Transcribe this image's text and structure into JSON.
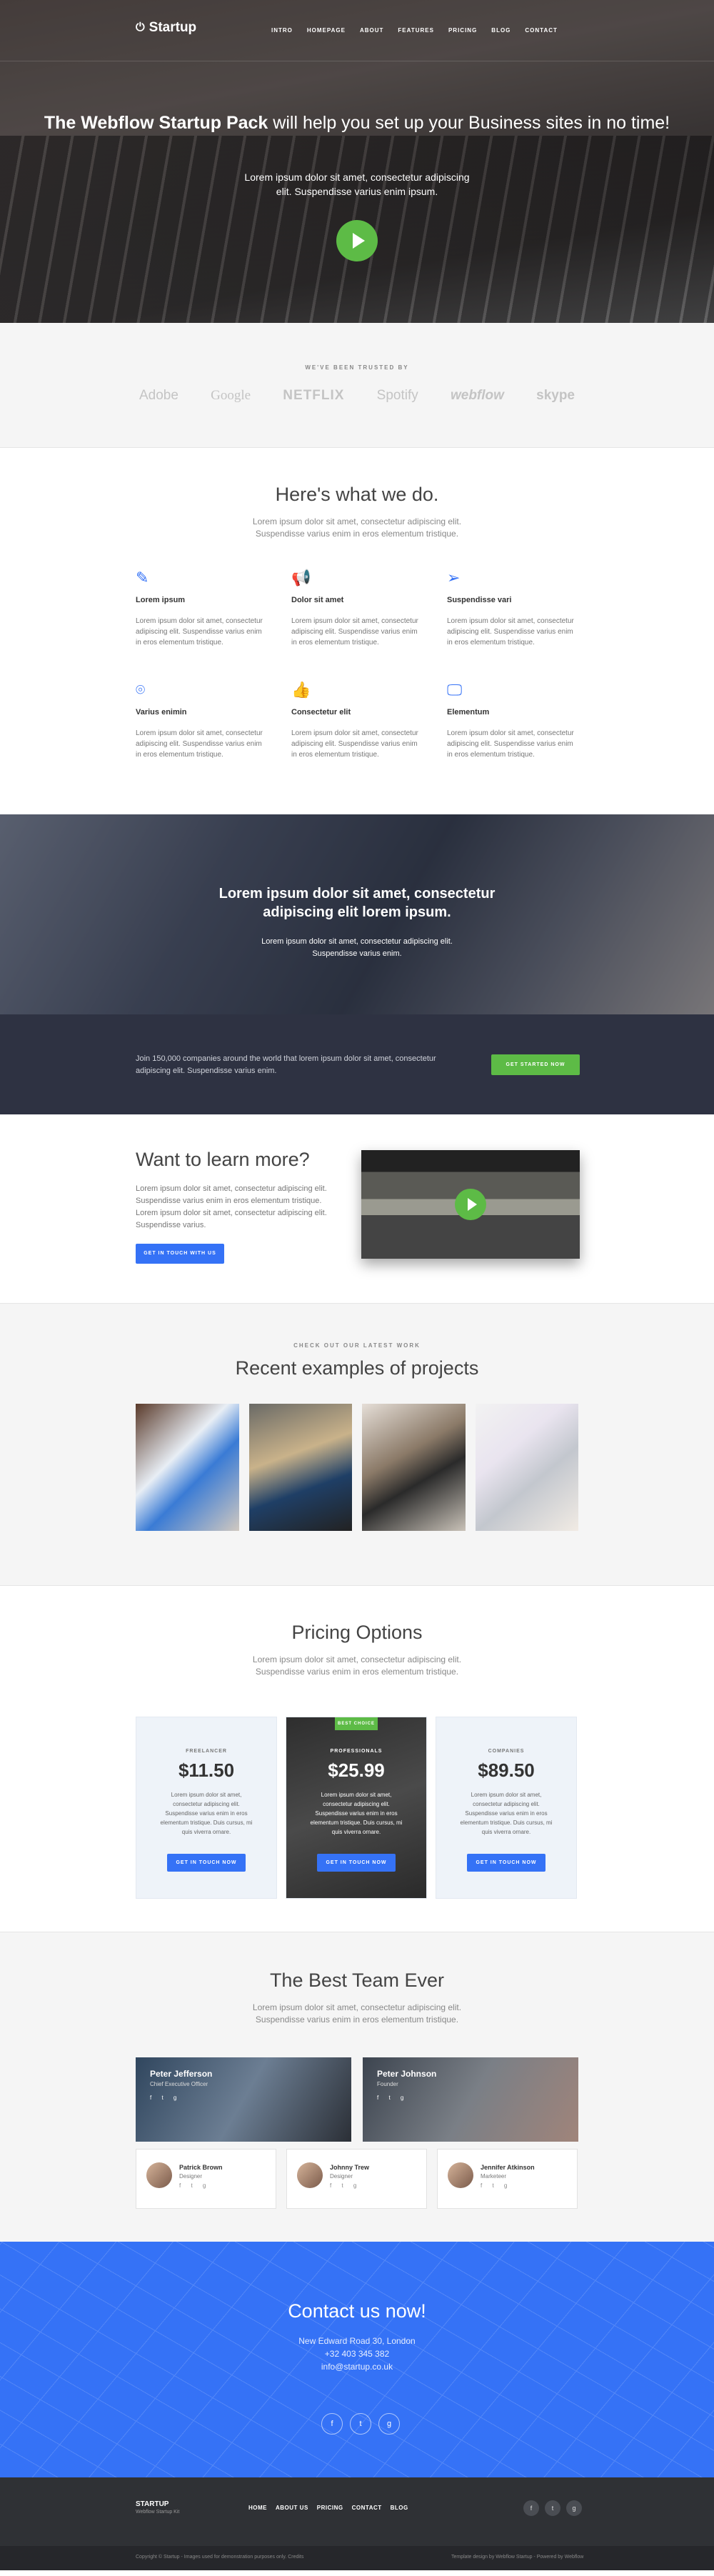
{
  "nav": {
    "logo": "Startup",
    "items": [
      "INTRO",
      "HOMEPAGE",
      "ABOUT",
      "FEATURES",
      "PRICING",
      "BLOG",
      "CONTACT"
    ]
  },
  "hero": {
    "title_bold": "The Webflow Startup Pack",
    "title_rest": "will help you set up your Business sites in no time!",
    "sub": "Lorem ipsum dolor sit amet, consectetur adipiscing elit. Suspendisse varius enim ipsum."
  },
  "trusted": {
    "label": "WE'VE BEEN TRUSTED BY",
    "logos": [
      "Adobe",
      "Google",
      "NETFLIX",
      "Spotify",
      "webflow",
      "skype"
    ]
  },
  "services": {
    "title": "Here's what we do.",
    "sub": "Lorem ipsum dolor sit amet, consectetur adipiscing elit. Suspendisse varius enim in eros elementum tristique.",
    "items": [
      {
        "icon": "pencil-icon",
        "title": "Lorem ipsum",
        "text": "Lorem ipsum dolor sit amet, consectetur adipiscing elit. Suspendisse varius enim in eros elementum tristique."
      },
      {
        "icon": "megaphone-icon",
        "title": "Dolor sit amet",
        "text": "Lorem ipsum dolor sit amet, consectetur adipiscing elit. Suspendisse varius enim in eros elementum tristique."
      },
      {
        "icon": "paper-plane-icon",
        "title": "Suspendisse vari",
        "text": "Lorem ipsum dolor sit amet, consectetur adipiscing elit. Suspendisse varius enim in eros elementum tristique."
      },
      {
        "icon": "camera-icon",
        "title": "Varius enimin",
        "text": "Lorem ipsum dolor sit amet, consectetur adipiscing elit. Suspendisse varius enim in eros elementum tristique."
      },
      {
        "icon": "thumbs-up-icon",
        "title": "Consectetur elit",
        "text": "Lorem ipsum dolor sit amet, consectetur adipiscing elit. Suspendisse varius enim in eros elementum tristique."
      },
      {
        "icon": "monitor-icon",
        "title": "Elementum",
        "text": "Lorem ipsum dolor sit amet, consectetur adipiscing elit. Suspendisse varius enim in eros elementum tristique."
      }
    ]
  },
  "office": {
    "title": "Lorem ipsum dolor sit amet, consectetur adipiscing elit lorem ipsum.",
    "sub": "Lorem ipsum dolor sit amet, consectetur adipiscing elit. Suspendisse varius enim."
  },
  "cta": {
    "text": "Join 150,000 companies around the world that lorem ipsum dolor sit amet, consectetur adipiscing elit. Suspendisse varius enim.",
    "button": "GET STARTED NOW"
  },
  "learn": {
    "title": "Want to learn more?",
    "text": "Lorem ipsum dolor sit amet, consectetur adipiscing elit. Suspendisse varius enim in eros elementum tristique. Lorem ipsum dolor sit amet, consectetur adipiscing elit. Suspendisse varius.",
    "button": "GET IN TOUCH WITH US"
  },
  "projects": {
    "label": "CHECK OUT OUR LATEST WORK",
    "title": "Recent examples of projects"
  },
  "pricing": {
    "title": "Pricing Options",
    "sub": "Lorem ipsum dolor sit amet, consectetur adipiscing elit. Suspendisse varius enim in eros elementum tristique.",
    "plans": [
      {
        "label": "FREELANCER",
        "price": "$11.50",
        "desc": "Lorem ipsum dolor sit amet, consectetur adipiscing elit. Suspendisse varius enim in eros elementum tristique. Duis cursus, mi quis viverra ornare.",
        "button": "GET IN TOUCH NOW"
      },
      {
        "label": "PROFESSIONALS",
        "price": "$25.99",
        "desc": "Lorem ipsum dolor sit amet, consectetur adipiscing elit. Suspendisse varius enim in eros elementum tristique. Duis cursus, mi quis viverra ornare.",
        "button": "GET IN TOUCH NOW",
        "badge": "BEST CHOICE"
      },
      {
        "label": "COMPANIES",
        "price": "$89.50",
        "desc": "Lorem ipsum dolor sit amet, consectetur adipiscing elit. Suspendisse varius enim in eros elementum tristique. Duis cursus, mi quis viverra ornare.",
        "button": "GET IN TOUCH NOW"
      }
    ]
  },
  "team": {
    "title": "The Best Team Ever",
    "sub": "Lorem ipsum dolor sit amet, consectetur adipiscing elit. Suspendisse varius enim in eros elementum tristique.",
    "leads": [
      {
        "name": "Peter Jefferson",
        "role": "Chief Executive Officer"
      },
      {
        "name": "Peter Johnson",
        "role": "Founder"
      }
    ],
    "members": [
      {
        "name": "Patrick Brown",
        "role": "Designer"
      },
      {
        "name": "Johnny Trew",
        "role": "Designer"
      },
      {
        "name": "Jennifer Atkinson",
        "role": "Marketeer"
      }
    ],
    "social": "f  t  g"
  },
  "contact": {
    "title": "Contact us now!",
    "address": "New Edward Road 30, London",
    "phone": "+32 403 345 382",
    "email": "info@startup.co.uk",
    "social": [
      "f",
      "t",
      "g"
    ]
  },
  "footer": {
    "logo": "STARTUP",
    "tagline": "Webflow Startup Kit",
    "nav": [
      "HOME",
      "ABOUT US",
      "PRICING",
      "CONTACT",
      "BLOG"
    ],
    "social": [
      "f",
      "t",
      "g"
    ],
    "copyright": "Copyright © Startup - Images used for demonstration purposes only. Credits",
    "credit": "Template design by Webflow Startup - Powered by Webflow"
  }
}
